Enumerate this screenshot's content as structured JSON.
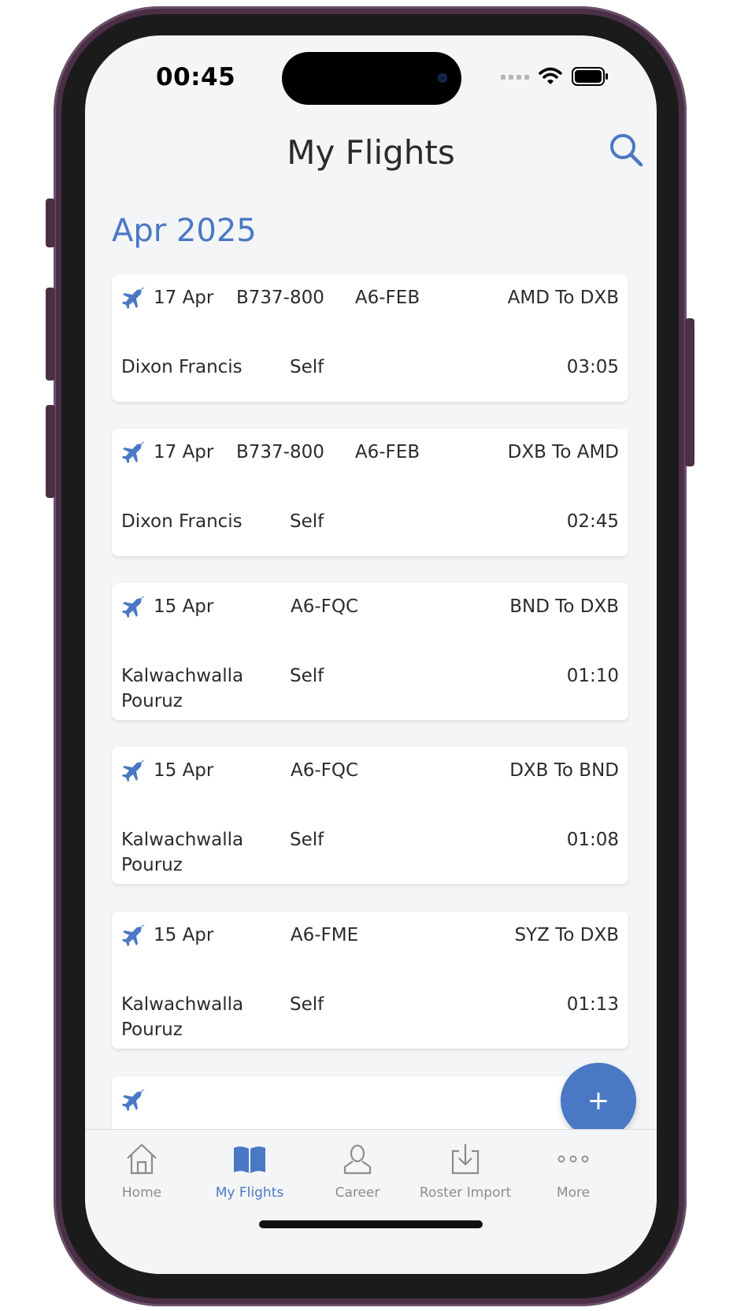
{
  "status_bar": {
    "time": "00:45"
  },
  "header": {
    "title": "My Flights"
  },
  "section": {
    "month": "Apr 2025"
  },
  "flights": [
    {
      "date": "17 Apr",
      "aircraft": "B737-800",
      "registration": "A6-FEB",
      "route": "AMD To DXB",
      "pilot": "Dixon Francis",
      "role": "Self",
      "duration": "03:05"
    },
    {
      "date": "17 Apr",
      "aircraft": "B737-800",
      "registration": "A6-FEB",
      "route": "DXB To AMD",
      "pilot": "Dixon Francis",
      "role": "Self",
      "duration": "02:45"
    },
    {
      "date": "15 Apr",
      "aircraft": "",
      "registration": "A6-FQC",
      "route": "BND To DXB",
      "pilot": "Kalwachwalla Pouruz",
      "role": "Self",
      "duration": "01:10"
    },
    {
      "date": "15 Apr",
      "aircraft": "",
      "registration": "A6-FQC",
      "route": "DXB To BND",
      "pilot": "Kalwachwalla Pouruz",
      "role": "Self",
      "duration": "01:08"
    },
    {
      "date": "15 Apr",
      "aircraft": "",
      "registration": "A6-FME",
      "route": "SYZ To DXB",
      "pilot": "Kalwachwalla Pouruz",
      "role": "Self",
      "duration": "01:13"
    }
  ],
  "fab": {
    "label": "+"
  },
  "tabs": [
    {
      "label": "Home",
      "icon": "home-icon"
    },
    {
      "label": "My Flights",
      "icon": "book-icon"
    },
    {
      "label": "Career",
      "icon": "person-icon"
    },
    {
      "label": "Roster Import",
      "icon": "download-icon"
    },
    {
      "label": "More",
      "icon": "more-dots-icon"
    }
  ],
  "colors": {
    "accent": "#4a78c4",
    "background": "#f4f5f7",
    "text": "#2b2b2b",
    "inactive": "#8c8c8c"
  }
}
